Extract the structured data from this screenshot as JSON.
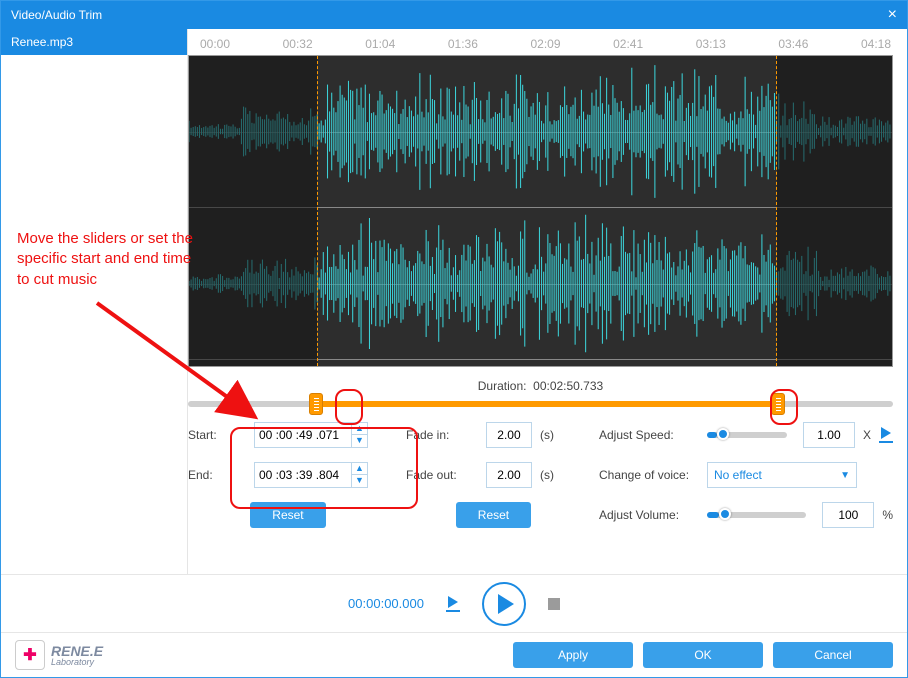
{
  "title": "Video/Audio Trim",
  "sidebar": {
    "file": "Renee.mp3"
  },
  "timeline": [
    "00:00",
    "00:32",
    "01:04",
    "01:36",
    "02:09",
    "02:41",
    "03:13",
    "03:46",
    "04:18"
  ],
  "duration": {
    "label": "Duration:",
    "value": "00:02:50.733"
  },
  "trim": {
    "start_label": "Start:",
    "start_value": "00 :00 :49 .071",
    "end_label": "End:",
    "end_value": "00 :03 :39 .804",
    "reset": "Reset"
  },
  "fade": {
    "in_label": "Fade in:",
    "in_value": "2.00",
    "out_label": "Fade out:",
    "out_value": "2.00",
    "unit": "(s)",
    "reset": "Reset"
  },
  "adjust": {
    "speed_label": "Adjust Speed:",
    "speed_value": "1.00",
    "speed_suffix": "X",
    "voice_label": "Change of voice:",
    "voice_value": "No effect",
    "volume_label": "Adjust Volume:",
    "volume_value": "100",
    "volume_suffix": "%"
  },
  "playback": {
    "time": "00:00:00.000"
  },
  "footer": {
    "logo_line1": "RENE.E",
    "logo_line2": "Laboratory",
    "apply": "Apply",
    "ok": "OK",
    "cancel": "Cancel"
  },
  "annotation": "Move the sliders or set the specific start and end time to cut music"
}
